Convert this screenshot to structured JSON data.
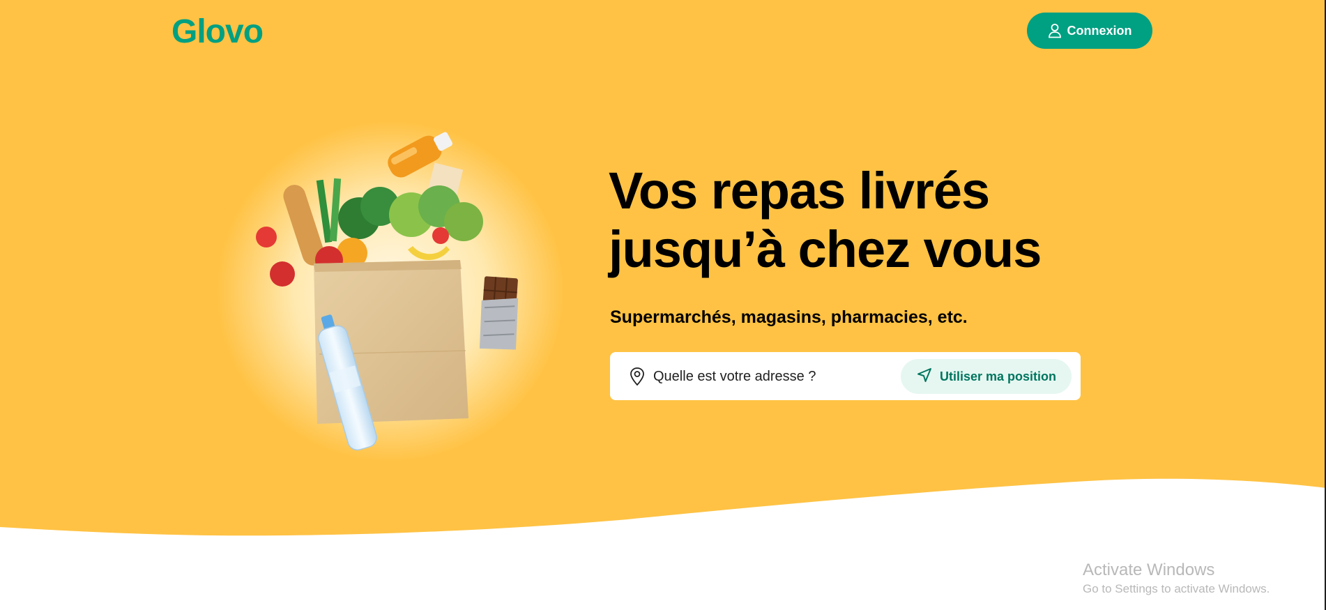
{
  "brand": {
    "logo_text": "Glovo",
    "accent_green": "#00a082",
    "hero_yellow": "#ffc244"
  },
  "header": {
    "login_label": "Connexion",
    "login_icon": "user-icon"
  },
  "hero": {
    "headline": "Vos repas livrés jusqu’à chez vous",
    "subtitle": "Supermarchés, magasins, pharmacies, etc.",
    "illustration": "grocery-bag-illustration"
  },
  "address_search": {
    "placeholder": "Quelle est votre adresse ?",
    "pin_icon": "location-pin-icon",
    "locate_label": "Utiliser ma position",
    "locate_icon": "navigation-arrow-icon"
  },
  "os_watermark": {
    "title": "Activate Windows",
    "subtitle": "Go to Settings to activate Windows."
  }
}
